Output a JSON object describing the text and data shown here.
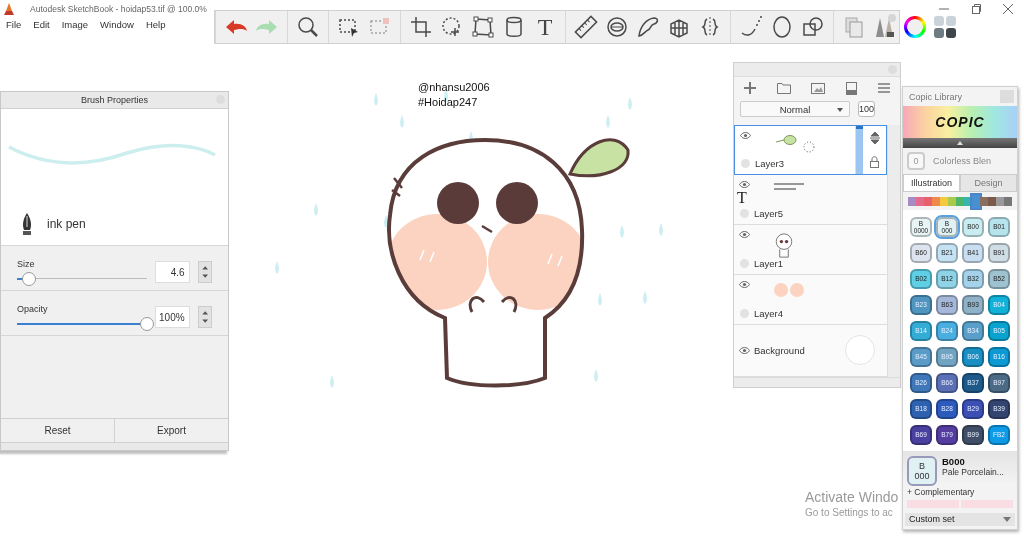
{
  "window": {
    "title": "Autodesk SketchBook - hoidap53.tif @ 100.0%"
  },
  "menu": [
    "File",
    "Edit",
    "Image",
    "Window",
    "Help"
  ],
  "toolbar": {
    "groups": [
      [
        {
          "kind": "undo",
          "disabled": false
        },
        {
          "kind": "redo",
          "disabled": true
        }
      ],
      [
        {
          "kind": "zoom",
          "disabled": false
        }
      ],
      [
        {
          "kind": "select",
          "disabled": false
        },
        {
          "kind": "transform",
          "disabled": true
        }
      ],
      [
        {
          "kind": "crop",
          "disabled": false
        },
        {
          "kind": "lasso",
          "disabled": false
        },
        {
          "kind": "distort",
          "disabled": false
        },
        {
          "kind": "fill",
          "disabled": false
        },
        {
          "kind": "text",
          "label": "T",
          "disabled": false
        }
      ],
      [
        {
          "kind": "ruler",
          "disabled": false
        },
        {
          "kind": "ellipse",
          "disabled": false
        },
        {
          "kind": "curve",
          "disabled": false
        },
        {
          "kind": "perspective",
          "disabled": false
        },
        {
          "kind": "symmetry",
          "disabled": false
        }
      ],
      [
        {
          "kind": "stroke",
          "disabled": false
        },
        {
          "kind": "circle",
          "disabled": false
        },
        {
          "kind": "shapes",
          "disabled": false
        }
      ],
      [
        {
          "kind": "layers",
          "disabled": false
        },
        {
          "kind": "brushes",
          "disabled": false
        },
        {
          "kind": "wheel",
          "disabled": false
        },
        {
          "kind": "swatches",
          "disabled": false
        }
      ]
    ]
  },
  "canvas": {
    "texts": [
      "@nhansu2006",
      "#Hoidap247"
    ]
  },
  "brush": {
    "title": "Brush Properties",
    "name": "ink pen",
    "sliders": [
      {
        "label": "Size",
        "level": 0.09,
        "value": "4.6"
      },
      {
        "label": "Opacity",
        "level": 1.0,
        "value": "100%"
      }
    ],
    "buttons": [
      "Reset",
      "Export"
    ]
  },
  "layers": {
    "blend_mode": "Normal",
    "opacity": "100",
    "items": [
      {
        "kind": "layer",
        "name": "Layer3",
        "selected": true,
        "visible": true
      },
      {
        "kind": "layer",
        "name": "Layer5",
        "badge": "T",
        "selected": false,
        "visible": true
      },
      {
        "kind": "layer",
        "name": "Layer1",
        "selected": false,
        "visible": true
      },
      {
        "kind": "layer",
        "name": "Layer4",
        "selected": false,
        "visible": true
      },
      {
        "kind": "background",
        "name": "Background",
        "color": "#ffffff",
        "selected": false,
        "visible": true
      }
    ]
  },
  "copic": {
    "title": "Copic Library",
    "logo": "COPIC",
    "blender": {
      "code": "0",
      "name": "Colorless Blen"
    },
    "tabs": [
      {
        "label": "Illustration",
        "selected": true
      },
      {
        "label": "Design",
        "selected": false
      }
    ],
    "hues": [
      {
        "color": "#a98bc4",
        "selected": false
      },
      {
        "color": "#e46b8c",
        "selected": false
      },
      {
        "color": "#e8606a",
        "selected": false
      },
      {
        "color": "#f08a4b",
        "selected": false
      },
      {
        "color": "#f5c842",
        "selected": false
      },
      {
        "color": "#a9c94a",
        "selected": false
      },
      {
        "color": "#4fb56a",
        "selected": false
      },
      {
        "color": "#35b7b0",
        "selected": false
      },
      {
        "color": "#4a90d0",
        "selected": true
      },
      {
        "color": "#8a6f60",
        "selected": false
      },
      {
        "color": "#7a5a4a",
        "selected": false
      },
      {
        "color": "#9a9a9a",
        "selected": false
      },
      {
        "color": "#777777",
        "selected": false
      }
    ],
    "swatches": [
      {
        "code": "B\n0000",
        "color": "#e8f4f4",
        "selected": false
      },
      {
        "code": "B\n000",
        "color": "#dff1f3",
        "selected": true
      },
      {
        "code": "B00",
        "color": "#c9ecf0",
        "selected": false
      },
      {
        "code": "B01",
        "color": "#b6e3ec",
        "selected": false
      },
      {
        "code": "B60",
        "color": "#dde4ef",
        "selected": false
      },
      {
        "code": "B21",
        "color": "#c4e2f2",
        "selected": false
      },
      {
        "code": "B41",
        "color": "#c9def0",
        "selected": false
      },
      {
        "code": "B91",
        "color": "#cfdde5",
        "selected": false
      },
      {
        "code": "B02",
        "color": "#5fcfe6",
        "selected": false
      },
      {
        "code": "B12",
        "color": "#8fd3e6",
        "selected": false
      },
      {
        "code": "B32",
        "color": "#a4d2ea",
        "selected": false
      },
      {
        "code": "B52",
        "color": "#9ec2cf",
        "selected": false
      },
      {
        "code": "B23",
        "color": "#4f95c0",
        "selected": false
      },
      {
        "code": "B63",
        "color": "#a6b8d9",
        "selected": false
      },
      {
        "code": "B93",
        "color": "#8fb2c8",
        "selected": false
      },
      {
        "code": "B04",
        "color": "#12b1d8",
        "selected": false
      },
      {
        "code": "B14",
        "color": "#33add6",
        "selected": false
      },
      {
        "code": "B24",
        "color": "#4aaee0",
        "selected": false
      },
      {
        "code": "B34",
        "color": "#5a9fc9",
        "selected": false
      },
      {
        "code": "B05",
        "color": "#0aa3cf",
        "selected": false
      },
      {
        "code": "B45",
        "color": "#5a9bc8",
        "selected": false
      },
      {
        "code": "B95",
        "color": "#71a4c3",
        "selected": false
      },
      {
        "code": "B06",
        "color": "#1a8fc3",
        "selected": false
      },
      {
        "code": "B16",
        "color": "#0c99d4",
        "selected": false
      },
      {
        "code": "B26",
        "color": "#3f78b9",
        "selected": false
      },
      {
        "code": "B66",
        "color": "#5a6fb5",
        "selected": false
      },
      {
        "code": "B37",
        "color": "#1d5a8a",
        "selected": false
      },
      {
        "code": "B97",
        "color": "#4a6a85",
        "selected": false
      },
      {
        "code": "B18",
        "color": "#2e62b0",
        "selected": false
      },
      {
        "code": "B28",
        "color": "#2d5bbd",
        "selected": false
      },
      {
        "code": "B29",
        "color": "#3b4fb5",
        "selected": false
      },
      {
        "code": "B39",
        "color": "#334470",
        "selected": false
      },
      {
        "code": "B69",
        "color": "#4940a0",
        "selected": false
      },
      {
        "code": "B79",
        "color": "#553ca0",
        "selected": false
      },
      {
        "code": "B99",
        "color": "#3f4e66",
        "selected": false
      },
      {
        "code": "FB2",
        "color": "#0d9be8",
        "selected": false
      }
    ],
    "current": {
      "swatch": "B\n000",
      "code": "B000",
      "name": "Pale Porcelain...",
      "color": "#dff1f3"
    },
    "complementary": "+ Complementary",
    "set": "Custom set"
  },
  "notice": {
    "title": "Activate Windo",
    "detail": "Go to Settings to ac"
  }
}
